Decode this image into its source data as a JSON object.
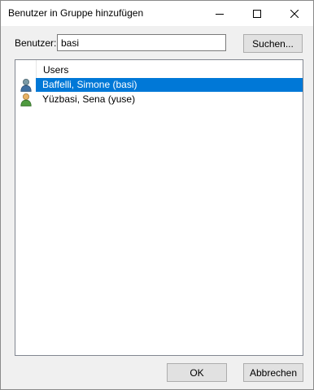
{
  "window": {
    "title": "Benutzer in Gruppe hinzufügen"
  },
  "titlebar_buttons": {
    "minimize_icon": "minimize-icon",
    "maximize_icon": "maximize-icon",
    "close_icon": "close-icon"
  },
  "search": {
    "label": "Benutzer:",
    "value": "basi",
    "button_label": "Suchen..."
  },
  "list": {
    "column_header": "Users",
    "rows": [
      {
        "label": "Baffelli, Simone (basi)",
        "icon": "user-icon",
        "selected": true
      },
      {
        "label": "Yüzbasi, Sena (yuse)",
        "icon": "user-icon",
        "selected": false
      }
    ]
  },
  "footer": {
    "ok_label": "OK",
    "cancel_label": "Abbrechen"
  },
  "colors": {
    "selection": "#0078d7",
    "dialog_bg": "#f0f0f0",
    "button_bg": "#e1e1e1"
  }
}
